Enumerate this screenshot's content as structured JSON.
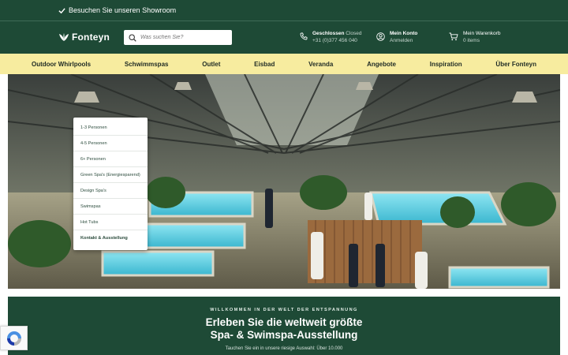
{
  "topbar": {
    "message": "Besuchen Sie unseren Showroom",
    "icon": "check-icon"
  },
  "header": {
    "logo_text": "Fonteyn",
    "search_placeholder": "Was suchen Sie?",
    "status": {
      "label": "Geschlossen",
      "state": "Closed",
      "phone": "+31 (0)377 456 040"
    },
    "account": {
      "label": "Mein Konto",
      "action": "Anmelden"
    },
    "cart": {
      "label": "Mein Warenkorb",
      "count": "0 items"
    }
  },
  "nav": [
    "Outdoor Whirlpools",
    "Schwimmspas",
    "Outlet",
    "Eisbad",
    "Veranda",
    "Angebote",
    "Inspiration",
    "Über Fonteyn"
  ],
  "dropdown": [
    "1-3 Personen",
    "4-5 Personen",
    "6+ Personen",
    "Green Spa's (Energiesparend)",
    "Design Spa's",
    "Swimspas",
    "Hot Tubs",
    "Kontakt & Ausstellung"
  ],
  "welcome": {
    "kicker": "WILLKOMMEN IN DER WELT DER ENTSPANNUNG",
    "headline_1": "Erleben Sie die weltweit größte",
    "headline_2": "Spa- & Swimspa-Ausstellung",
    "sub": "Tauchen Sie ein in unsere riesige Auswahl: Über 10.000"
  },
  "colors": {
    "brand_green": "#1e4a36",
    "nav_yellow": "#f7ec9f"
  }
}
